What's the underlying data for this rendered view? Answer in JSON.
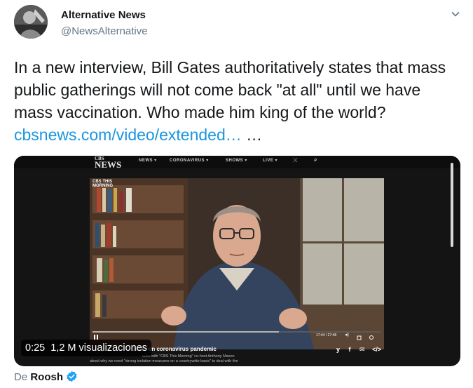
{
  "tweet": {
    "display_name": "Alternative News",
    "handle": "@NewsAlternative",
    "text_before_link": "In a new interview, Bill Gates authoritatively states that mass public gatherings will not come back \"at all\" until we have mass vaccination. Who made him king of the world? ",
    "link_text": "cbsnews.com/video/extended…",
    "text_after_link": " …"
  },
  "video": {
    "logo_line1": "CBS",
    "logo_line2": "NEWS",
    "nav": [
      "NEWS ▾",
      "CORONAVIRUS ▾",
      "SHOWS ▾",
      "LIVE ▾"
    ],
    "corner_line1": "CBS THIS",
    "corner_line2": "MORNING",
    "player_time": "17:44 / 27:48",
    "headline": "Gates on coronavirus pandemic",
    "subline1": "talks with \"CBS This Morning\" co-host Anthony Mason",
    "subline2": "about why we need \"strong isolation measures on a countrywide basis\" to deal with the",
    "elapsed": "0:25",
    "views": "1,2 M visualizaciones"
  },
  "attribution": {
    "prefix": "De ",
    "author": "Roosh"
  },
  "colors": {
    "link": "#1b95e0",
    "verified": "#1da1f2"
  },
  "icons": [
    "chevron-down-icon",
    "verified-badge-icon",
    "share-twitter-icon",
    "share-facebook-icon",
    "share-email-icon",
    "embed-icon"
  ]
}
